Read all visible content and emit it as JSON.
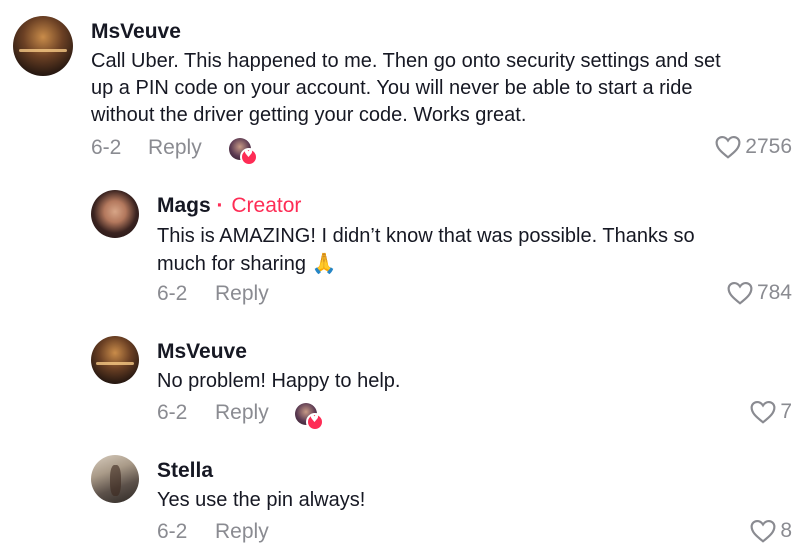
{
  "comments": [
    {
      "author": "MsVeuve",
      "badge": "",
      "text": [
        "Call Uber. This happened to me. Then go onto security settings and set",
        "up a PIN code on your account. You will never be able to start a ride",
        "without the driver getting your code. Works great."
      ],
      "date": "6-2",
      "reply_label": "Reply",
      "likes": "2756",
      "avatar_icon": "user-avatar-candles",
      "creator_liked": true
    },
    {
      "author": "Mags",
      "badge": "Creator",
      "badge_separator": "·",
      "text": [
        "This is AMAZING! I didn’t know that was possible. Thanks so",
        "much for sharing"
      ],
      "emoji": "🙏",
      "date": "6-2",
      "reply_label": "Reply",
      "likes": "784",
      "avatar_icon": "user-avatar-woman",
      "creator_liked": false
    },
    {
      "author": "MsVeuve",
      "badge": "",
      "text": [
        "No problem! Happy to help."
      ],
      "date": "6-2",
      "reply_label": "Reply",
      "likes": "7",
      "avatar_icon": "user-avatar-candles",
      "creator_liked": true
    },
    {
      "author": "Stella",
      "badge": "",
      "text": [
        "Yes use the pin always!"
      ],
      "date": "6-2",
      "reply_label": "Reply",
      "likes": "8",
      "avatar_icon": "user-avatar-stella",
      "creator_liked": false
    }
  ],
  "colors": {
    "accent": "#fe2c55",
    "text": "#161823",
    "muted": "#8a8b91"
  }
}
